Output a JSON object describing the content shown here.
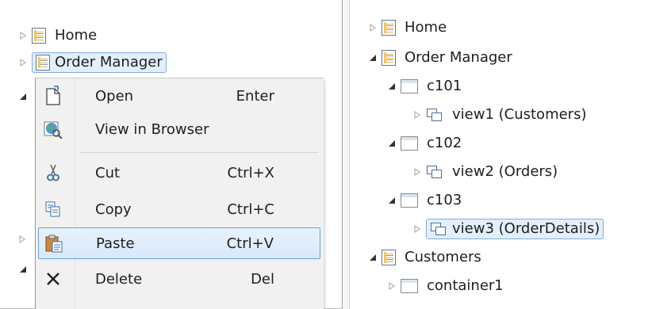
{
  "left_tree": {
    "home": "Home",
    "order_manager": "Order Manager"
  },
  "context_menu": {
    "open": {
      "label": "Open",
      "shortcut": "Enter"
    },
    "view_in_browser": {
      "label": "View in Browser"
    },
    "cut": {
      "label": "Cut",
      "shortcut": "Ctrl+X"
    },
    "copy": {
      "label": "Copy",
      "shortcut": "Ctrl+C"
    },
    "paste": {
      "label": "Paste",
      "shortcut": "Ctrl+V"
    },
    "delete": {
      "label": "Delete",
      "shortcut": "Del"
    }
  },
  "right_tree": {
    "home": "Home",
    "order_manager": "Order Manager",
    "c101": "c101",
    "view1": "view1 (Customers)",
    "c102": "c102",
    "view2": "view2 (Orders)",
    "c103": "c103",
    "view3": "view3 (OrderDetails)",
    "customers": "Customers",
    "container1": "container1"
  },
  "icons": {
    "page": "page-icon",
    "container": "container-icon",
    "view": "view-icon",
    "open": "open-document-icon",
    "browser": "globe-icon",
    "cut": "scissors-icon",
    "copy": "copy-icon",
    "paste": "clipboard-paste-icon",
    "delete": "x-delete-icon"
  },
  "colors": {
    "selection_fill": "#e3effc",
    "selection_border": "#84acdd",
    "menu_highlight_border": "#6a9fd8",
    "menu_background": "#f1f1f1"
  }
}
